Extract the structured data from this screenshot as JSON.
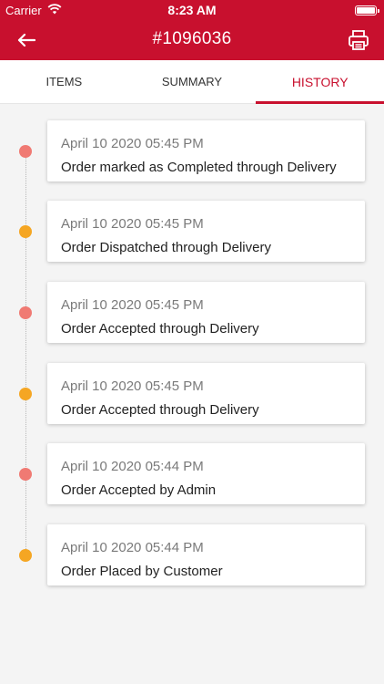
{
  "status_bar": {
    "carrier": "Carrier",
    "time": "8:23 AM"
  },
  "nav": {
    "title": "#1096036",
    "back_icon": "arrow-left-icon",
    "print_icon": "printer-icon"
  },
  "tabs": [
    {
      "label": "ITEMS",
      "active": false
    },
    {
      "label": "SUMMARY",
      "active": false
    },
    {
      "label": "HISTORY",
      "active": true
    }
  ],
  "colors": {
    "brand": "#c8102e",
    "dot_red": "#f07a73",
    "dot_orange": "#f5a623"
  },
  "history": [
    {
      "date": "April 10 2020 05:45 PM",
      "text": "Order marked as Completed through Delivery",
      "dot_color": "#f07a73"
    },
    {
      "date": "April 10 2020 05:45 PM",
      "text": "Order Dispatched through Delivery",
      "dot_color": "#f5a623"
    },
    {
      "date": "April 10 2020 05:45 PM",
      "text": "Order Accepted through Delivery",
      "dot_color": "#f07a73"
    },
    {
      "date": "April 10 2020 05:45 PM",
      "text": "Order Accepted through Delivery",
      "dot_color": "#f5a623"
    },
    {
      "date": "April 10 2020 05:44 PM",
      "text": "Order Accepted by Admin",
      "dot_color": "#f07a73"
    },
    {
      "date": "April 10 2020 05:44 PM",
      "text": "Order Placed by Customer",
      "dot_color": "#f5a623"
    }
  ]
}
